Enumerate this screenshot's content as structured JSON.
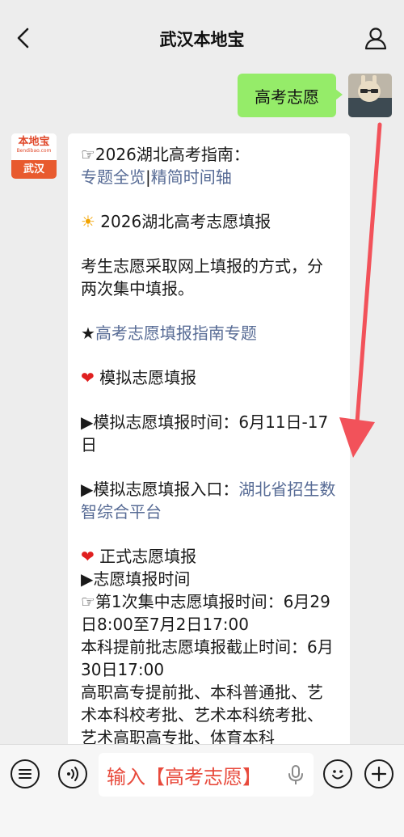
{
  "header": {
    "title": "武汉本地宝"
  },
  "outgoing": {
    "message": "高考志愿"
  },
  "incoming": {
    "avatar_logo": "本地宝",
    "avatar_domain": "Bendibao.com",
    "avatar_city": "武汉",
    "line1": "☞2026湖北高考指南：",
    "link_overview": "专题全览",
    "separator": "|",
    "link_timeline": "精简时间轴",
    "sun_emoji": "☀",
    "section_title": "2026湖北高考志愿填报",
    "desc": "考生志愿采取网上填报的方式，分两次集中填报。",
    "star": "★",
    "link_guide": "高考志愿填报指南专题",
    "heart": "❤",
    "mock_title": "模拟志愿填报",
    "mock_time": "▶模拟志愿填报时间：6月11日-17日",
    "mock_entry_prefix": "▶模拟志愿填报入口：",
    "link_platform": "湖北省招生数智综合平台",
    "formal_title": "正式志愿填报",
    "formal_time_head": "▶志愿填报时间",
    "first_round": "☞第1次集中志愿填报时间：6月29日8:00至7月2日17:00",
    "early_deadline": "本科提前批志愿填报截止时间：6月30日17:00",
    "batches": "高职高专提前批、本科普通批、艺术本科校考批、艺术本科统考批、艺术高职高专批、体育本科"
  },
  "input_bar": {
    "text": "输入【高考志愿】"
  },
  "colors": {
    "bubble_out": "#95ec69",
    "link": "#576b95",
    "arrow": "#f2525a",
    "input_text": "#e84a3c"
  }
}
